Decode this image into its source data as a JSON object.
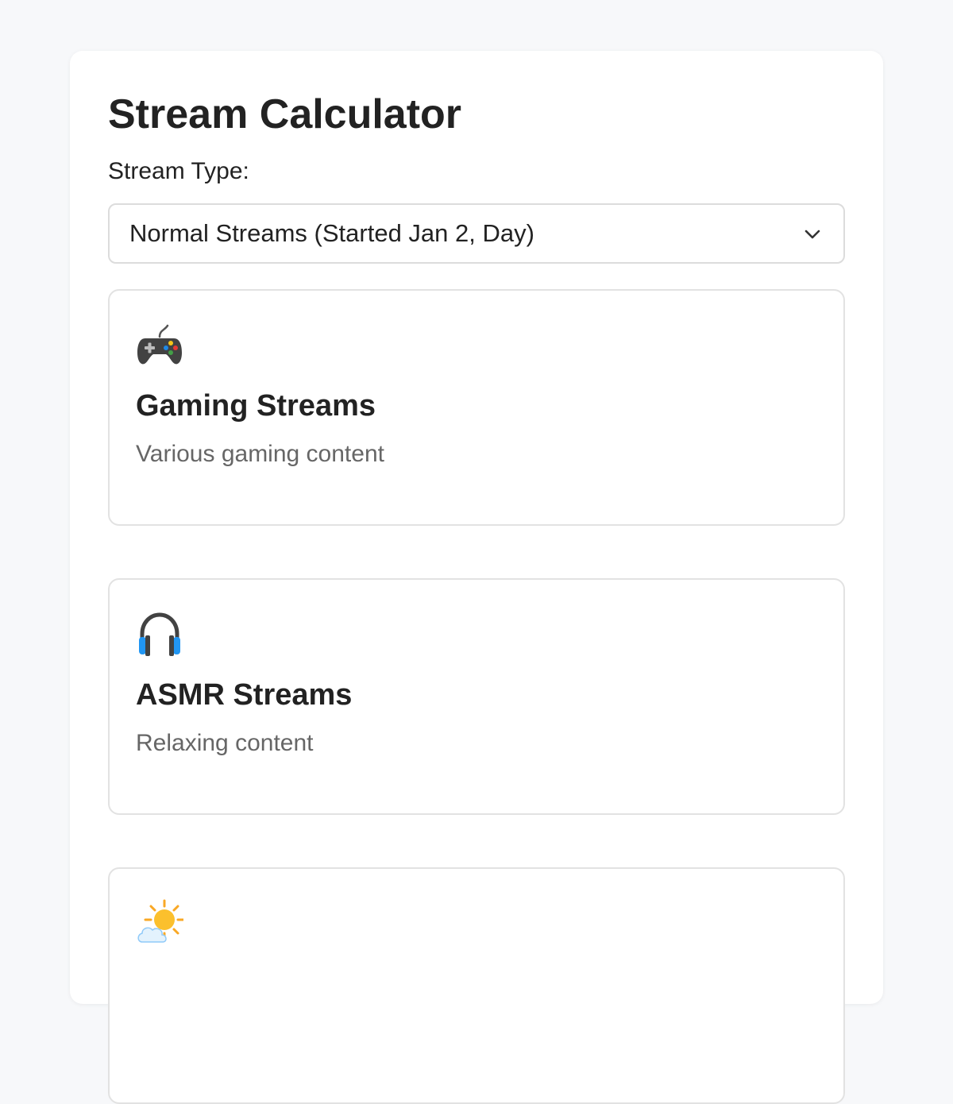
{
  "page": {
    "title": "Stream Calculator"
  },
  "stream_type": {
    "label": "Stream Type:",
    "selected": "Normal Streams (Started Jan 2, Day)"
  },
  "cards": [
    {
      "icon": "game-controller-icon",
      "title": "Gaming Streams",
      "description": "Various gaming content"
    },
    {
      "icon": "headphones-icon",
      "title": "ASMR Streams",
      "description": "Relaxing content"
    },
    {
      "icon": "sun-behind-cloud-icon",
      "title": "",
      "description": ""
    }
  ],
  "colors": {
    "page_background": "#f7f8fa",
    "panel_background": "#ffffff",
    "border": "#e2e2e2",
    "text_primary": "#222222",
    "text_secondary": "#666666",
    "headphones_accent": "#2196f3",
    "sun_accent": "#f9a825"
  }
}
